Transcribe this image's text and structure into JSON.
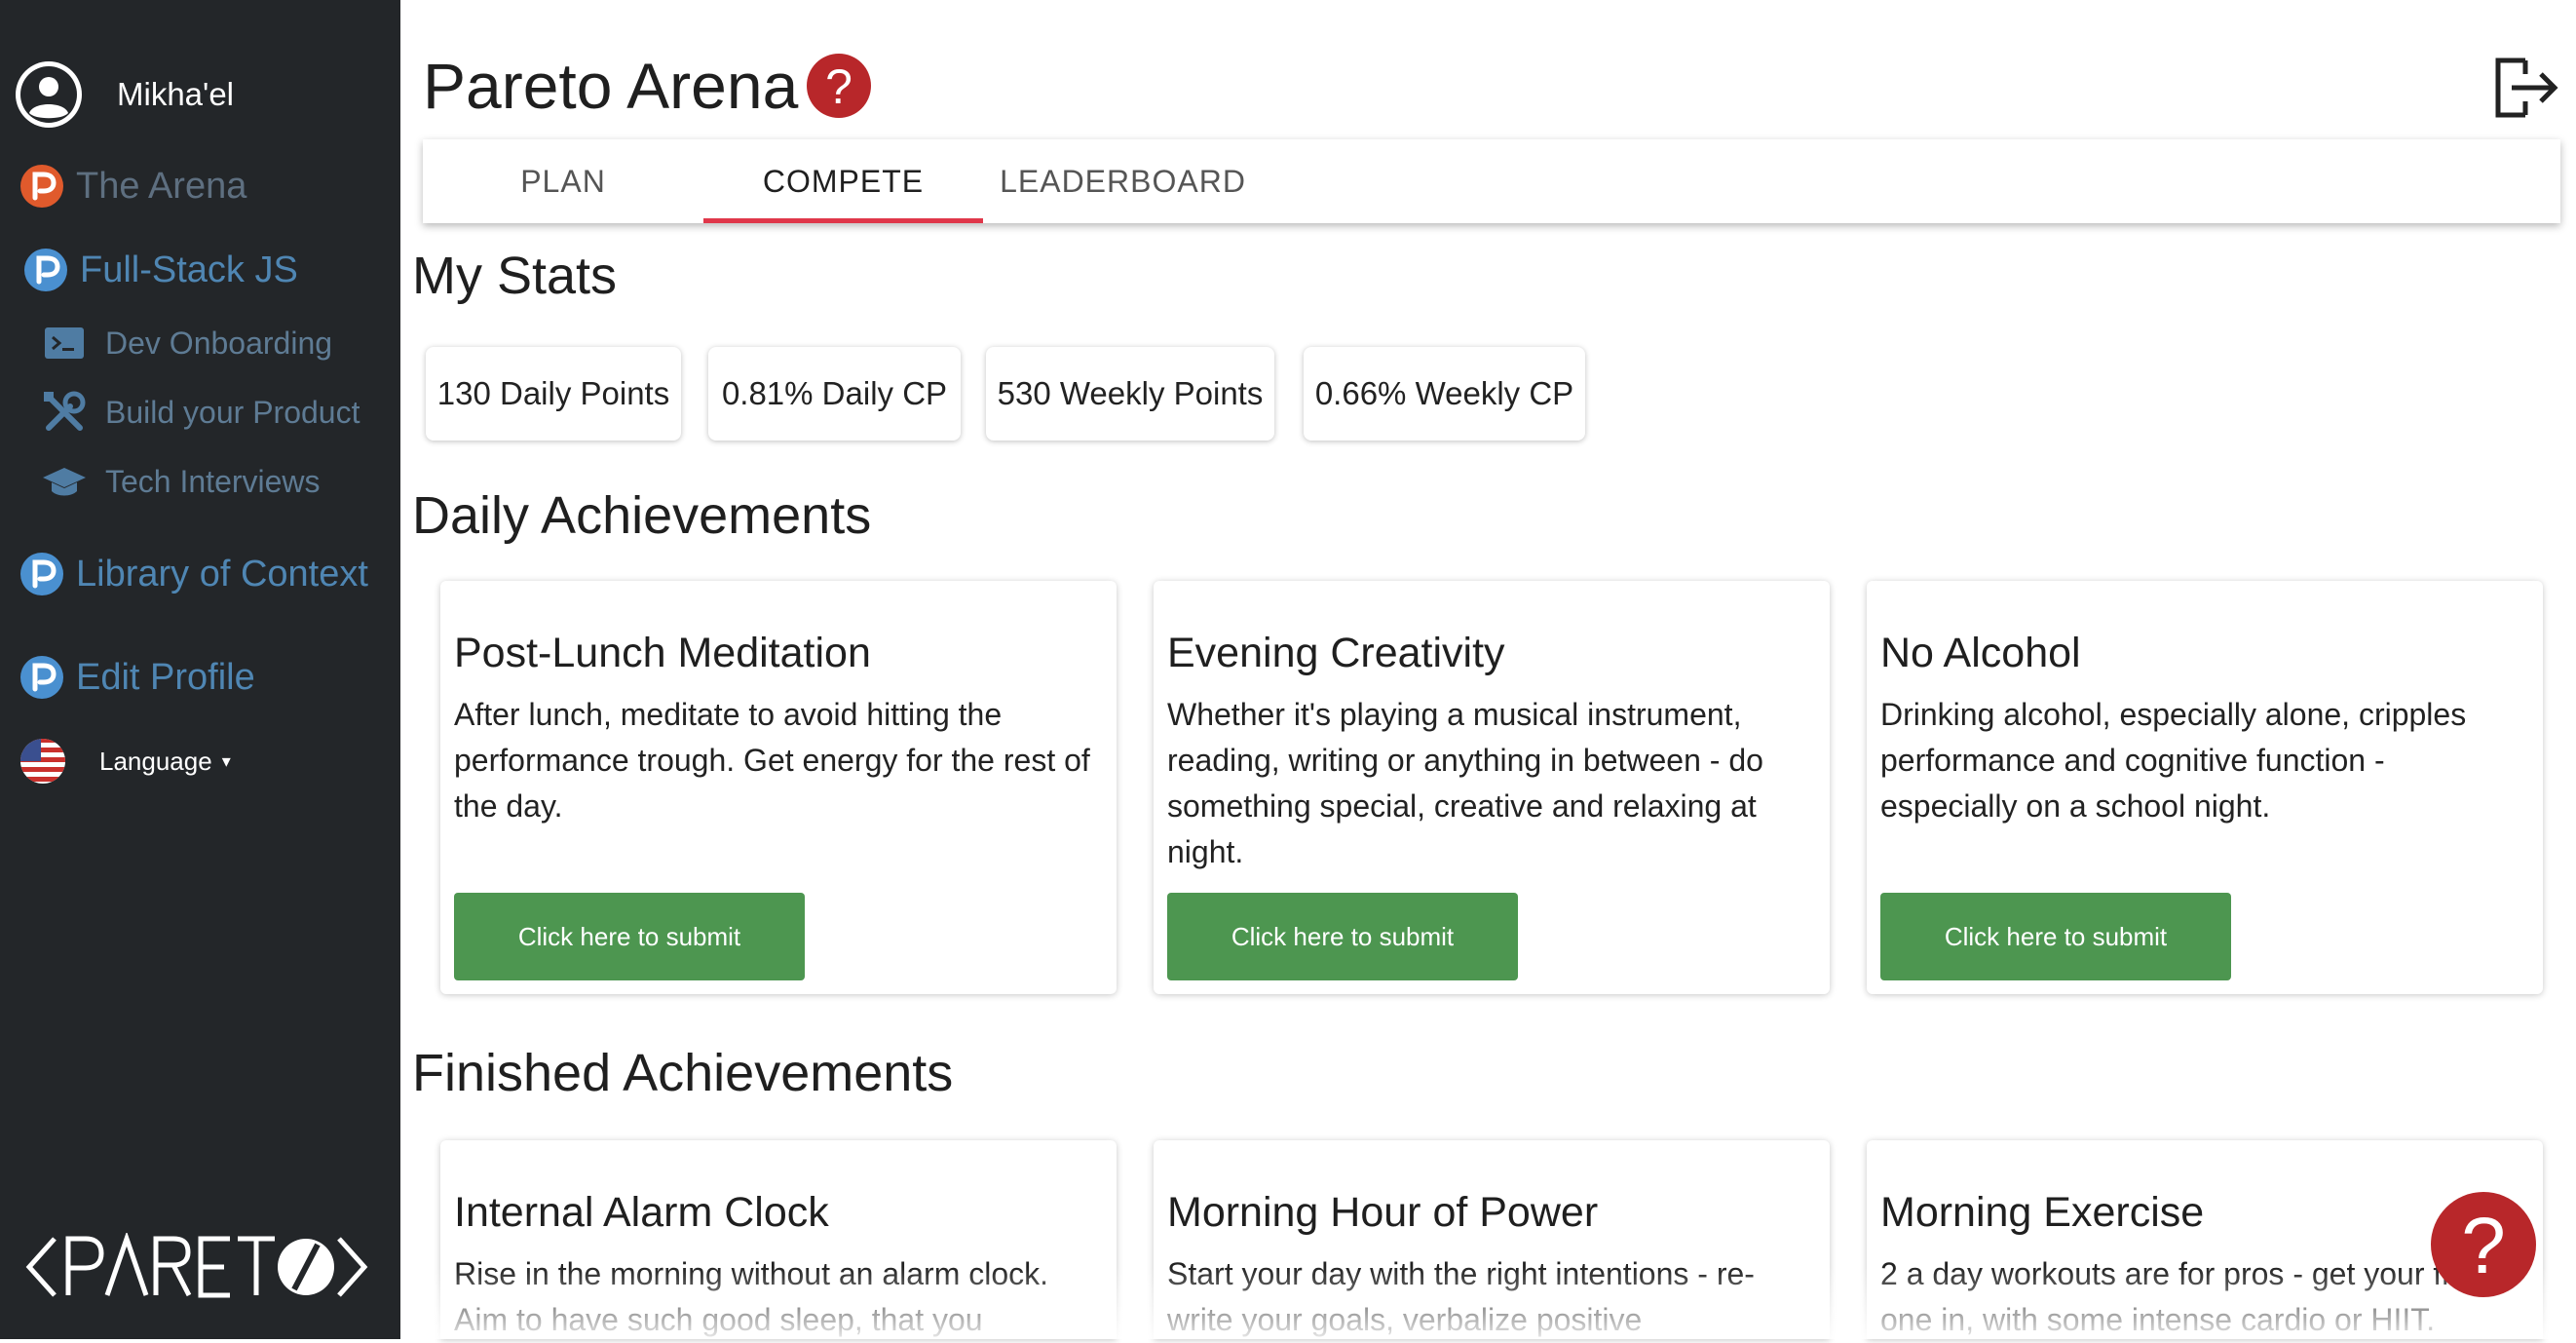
{
  "sidebar": {
    "user_name": "Mikha'el",
    "items": [
      {
        "label": "The Arena"
      },
      {
        "label": "Full-Stack JS"
      },
      {
        "label": "Dev Onboarding"
      },
      {
        "label": "Build your Product"
      },
      {
        "label": "Tech Interviews"
      },
      {
        "label": "Library of Context"
      },
      {
        "label": "Edit Profile"
      }
    ],
    "language_label": "Language",
    "logo_text": "<PARETO>"
  },
  "header": {
    "title": "Pareto Arena",
    "tabs": [
      {
        "label": "PLAN"
      },
      {
        "label": "COMPETE",
        "active": true
      },
      {
        "label": "LEADERBOARD"
      }
    ]
  },
  "stats": {
    "heading": "My Stats",
    "items": [
      {
        "label": "130 Daily Points"
      },
      {
        "label": "0.81% Daily CP"
      },
      {
        "label": "530 Weekly Points"
      },
      {
        "label": "0.66% Weekly CP"
      }
    ]
  },
  "daily": {
    "heading": "Daily Achievements",
    "cards": [
      {
        "title": "Post-Lunch Meditation",
        "description": "After lunch, meditate to avoid hitting the performance trough. Get energy for the rest of the day.",
        "button": "Click here to submit"
      },
      {
        "title": "Evening Creativity",
        "description": "Whether it's playing a musical instrument, reading, writing or anything in between - do something special, creative and relaxing at night.",
        "button": "Click here to submit"
      },
      {
        "title": "No Alcohol",
        "description": "Drinking alcohol, especially alone, cripples performance and cognitive function - especially on a school night.",
        "button": "Click here to submit"
      }
    ]
  },
  "finished": {
    "heading": "Finished Achievements",
    "cards": [
      {
        "title": "Internal Alarm Clock",
        "description": "Rise in the morning without an alarm clock. Aim to have such good sleep, that you"
      },
      {
        "title": "Morning Hour of Power",
        "description": "Start your day with the right intentions - re-write your goals, verbalize positive"
      },
      {
        "title": "Morning Exercise",
        "description": "2 a day workouts are for pros - get your first one in, with some intense cardio or HIIT."
      }
    ]
  },
  "colors": {
    "sidebar_bg": "#232629",
    "sidebar_link": "#4f86b3",
    "tab_underline": "#e0374a",
    "submit_button": "#4d9650",
    "help_icon": "#b8272a"
  },
  "icons": {
    "user": "user-circle-icon",
    "arena": "pareto-p-orange-icon",
    "courses": "pareto-p-blue-icon",
    "terminal": "terminal-icon",
    "tools": "tools-icon",
    "graduation": "graduation-cap-icon",
    "flag": "us-flag-icon",
    "help": "question-circle-icon",
    "logout": "logout-icon"
  }
}
